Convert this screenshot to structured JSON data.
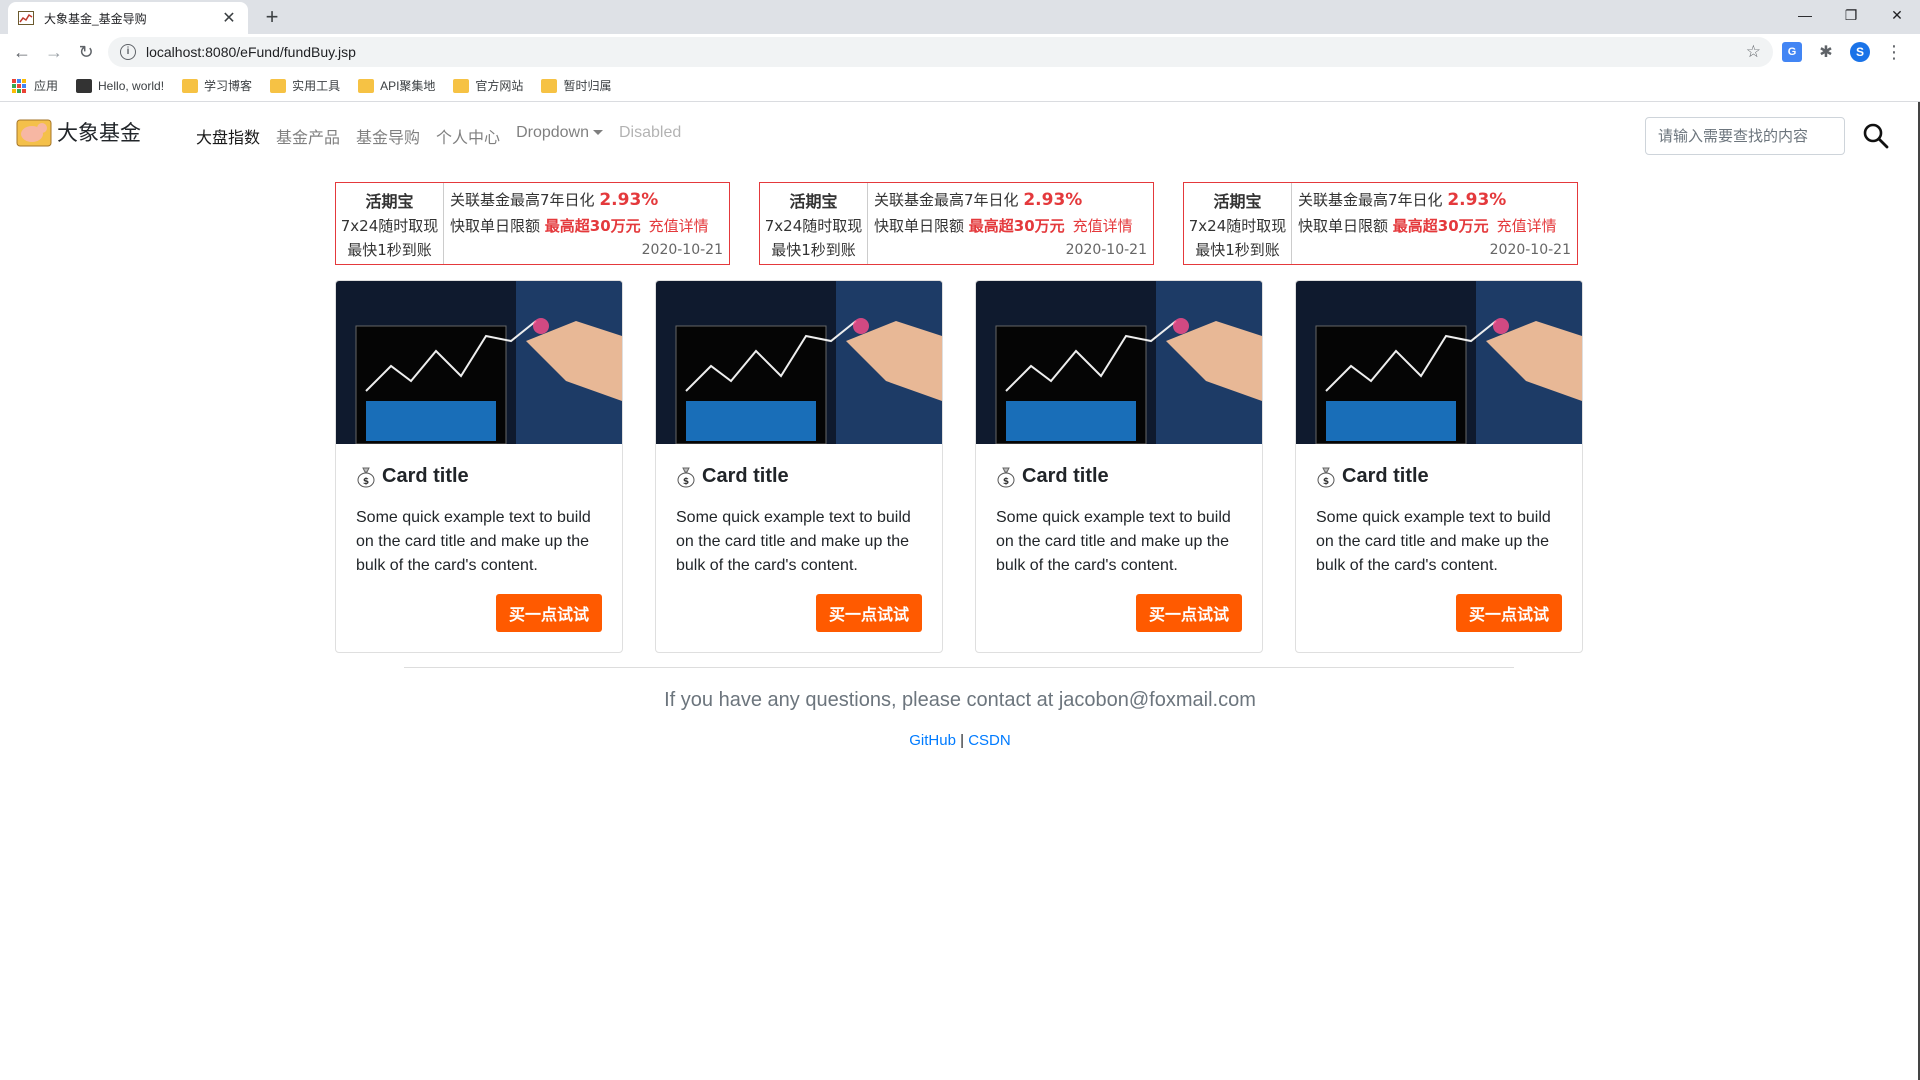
{
  "browser": {
    "tab_title": "大象基金_基金导购",
    "url": "localhost:8080/eFund/fundBuy.jsp",
    "avatar_letter": "S",
    "bookmarks": [
      "应用",
      "Hello, world!",
      "学习博客",
      "实用工具",
      "API聚集地",
      "官方网站",
      "暂时归属"
    ]
  },
  "navbar": {
    "brand": "大象基金",
    "links": [
      "大盘指数",
      "基金产品",
      "基金导购",
      "个人中心",
      "Dropdown",
      "Disabled"
    ],
    "search_placeholder": "请输入需要查找的内容"
  },
  "promos": [
    {
      "name": "活期宝",
      "line1": "7x24随时取现",
      "line2": "最快1秒到账",
      "rate_label": "关联基金最高7年日化",
      "rate": "2.93%",
      "limit_label": "快取单日限额",
      "limit": "最高超30万元",
      "link": "充值详情",
      "date": "2020-10-21"
    },
    {
      "name": "活期宝",
      "line1": "7x24随时取现",
      "line2": "最快1秒到账",
      "rate_label": "关联基金最高7年日化",
      "rate": "2.93%",
      "limit_label": "快取单日限额",
      "limit": "最高超30万元",
      "link": "充值详情",
      "date": "2020-10-21"
    },
    {
      "name": "活期宝",
      "line1": "7x24随时取现",
      "line2": "最快1秒到账",
      "rate_label": "关联基金最高7年日化",
      "rate": "2.93%",
      "limit_label": "快取单日限额",
      "limit": "最高超30万元",
      "link": "充值详情",
      "date": "2020-10-21"
    }
  ],
  "cards": [
    {
      "title": "Card title",
      "text": "Some quick example text to build on the card title and make up the bulk of the card's content.",
      "button": "买一点试试"
    },
    {
      "title": "Card title",
      "text": "Some quick example text to build on the card title and make up the bulk of the card's content.",
      "button": "买一点试试"
    },
    {
      "title": "Card title",
      "text": "Some quick example text to build on the card title and make up the bulk of the card's content.",
      "button": "买一点试试"
    },
    {
      "title": "Card title",
      "text": "Some quick example text to build on the card title and make up the bulk of the card's content.",
      "button": "买一点试试"
    }
  ],
  "footer": {
    "contact": "If you have any questions, please contact at jacobon@foxmail.com",
    "link1": "GitHub",
    "separator": "|",
    "link2": "CSDN"
  },
  "colors": {
    "accent_red": "#e4393c",
    "button_orange": "#ff5a00",
    "link_blue": "#007bff"
  }
}
